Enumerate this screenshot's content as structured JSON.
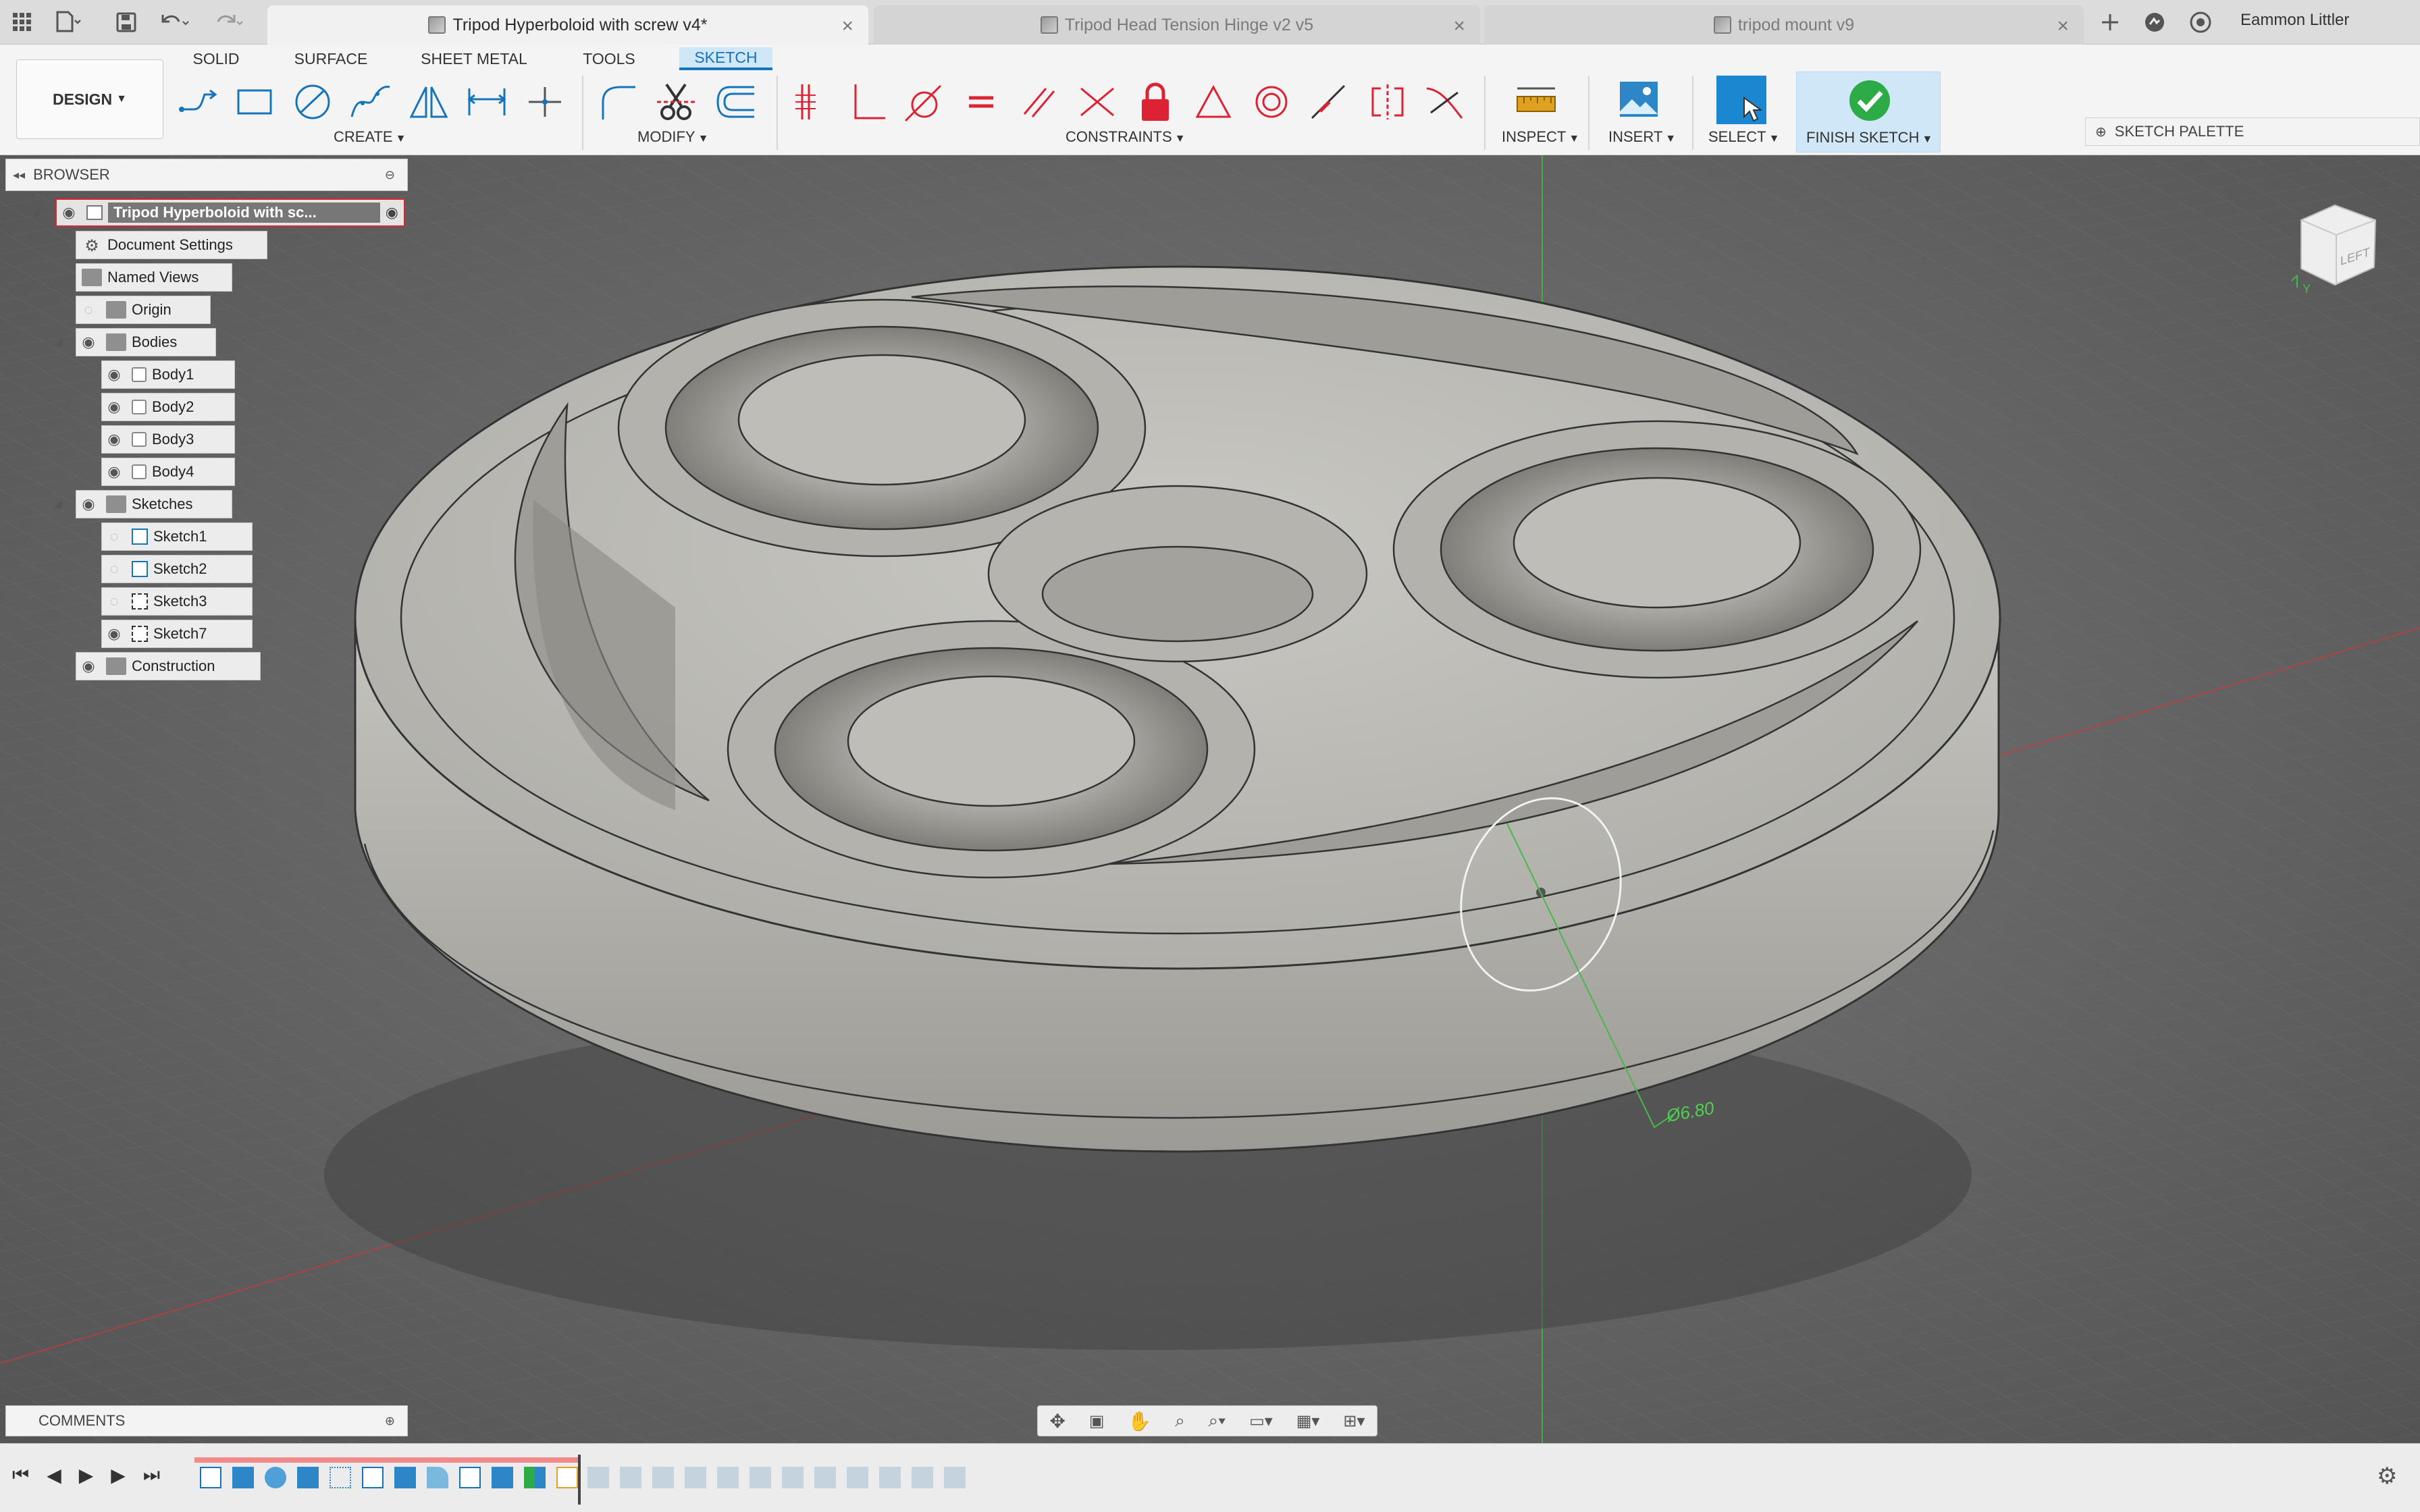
{
  "tabs": [
    {
      "label": "Tripod Hyperboloid with screw v4*",
      "active": true
    },
    {
      "label": "Tripod Head Tension Hinge v2 v5",
      "active": false
    },
    {
      "label": "tripod mount v9",
      "active": false
    }
  ],
  "user": {
    "name": "Eammon Littler"
  },
  "workspace": {
    "label": "DESIGN"
  },
  "workspace_tabs": [
    "SOLID",
    "SURFACE",
    "SHEET METAL",
    "TOOLS",
    "SKETCH"
  ],
  "active_workspace_tab": "SKETCH",
  "groups": {
    "create": "CREATE",
    "modify": "MODIFY",
    "constraints": "CONSTRAINTS",
    "inspect": "INSPECT",
    "insert": "INSERT",
    "select": "SELECT",
    "finish": "FINISH SKETCH"
  },
  "sketch_palette": {
    "label": "SKETCH PALETTE"
  },
  "browser": {
    "title": "BROWSER",
    "root": "Tripod Hyperboloid with sc...",
    "items": [
      {
        "label": "Document Settings",
        "icon": "gear-icon"
      },
      {
        "label": "Named Views",
        "icon": "folder-icon"
      },
      {
        "label": "Origin",
        "icon": "folder-icon"
      },
      {
        "label": "Bodies",
        "icon": "folder-icon"
      },
      {
        "label": "Body1",
        "icon": "body-icon"
      },
      {
        "label": "Body2",
        "icon": "body-icon"
      },
      {
        "label": "Body3",
        "icon": "body-icon"
      },
      {
        "label": "Body4",
        "icon": "body-icon"
      },
      {
        "label": "Sketches",
        "icon": "folder-icon"
      },
      {
        "label": "Sketch1",
        "icon": "sketch-icon"
      },
      {
        "label": "Sketch2",
        "icon": "sketch-icon"
      },
      {
        "label": "Sketch3",
        "icon": "sketch-icon"
      },
      {
        "label": "Sketch7",
        "icon": "sketch-icon"
      },
      {
        "label": "Construction",
        "icon": "folder-icon"
      }
    ]
  },
  "comments": {
    "title": "COMMENTS"
  },
  "viewport": {
    "dimension_label": "Ø6.80",
    "viewcube_label": "LEFT",
    "axis_label": "Y"
  },
  "colors": {
    "accent": "#1574ba",
    "finish_green": "#2dab47",
    "model_gray": "#b9b8b2"
  }
}
